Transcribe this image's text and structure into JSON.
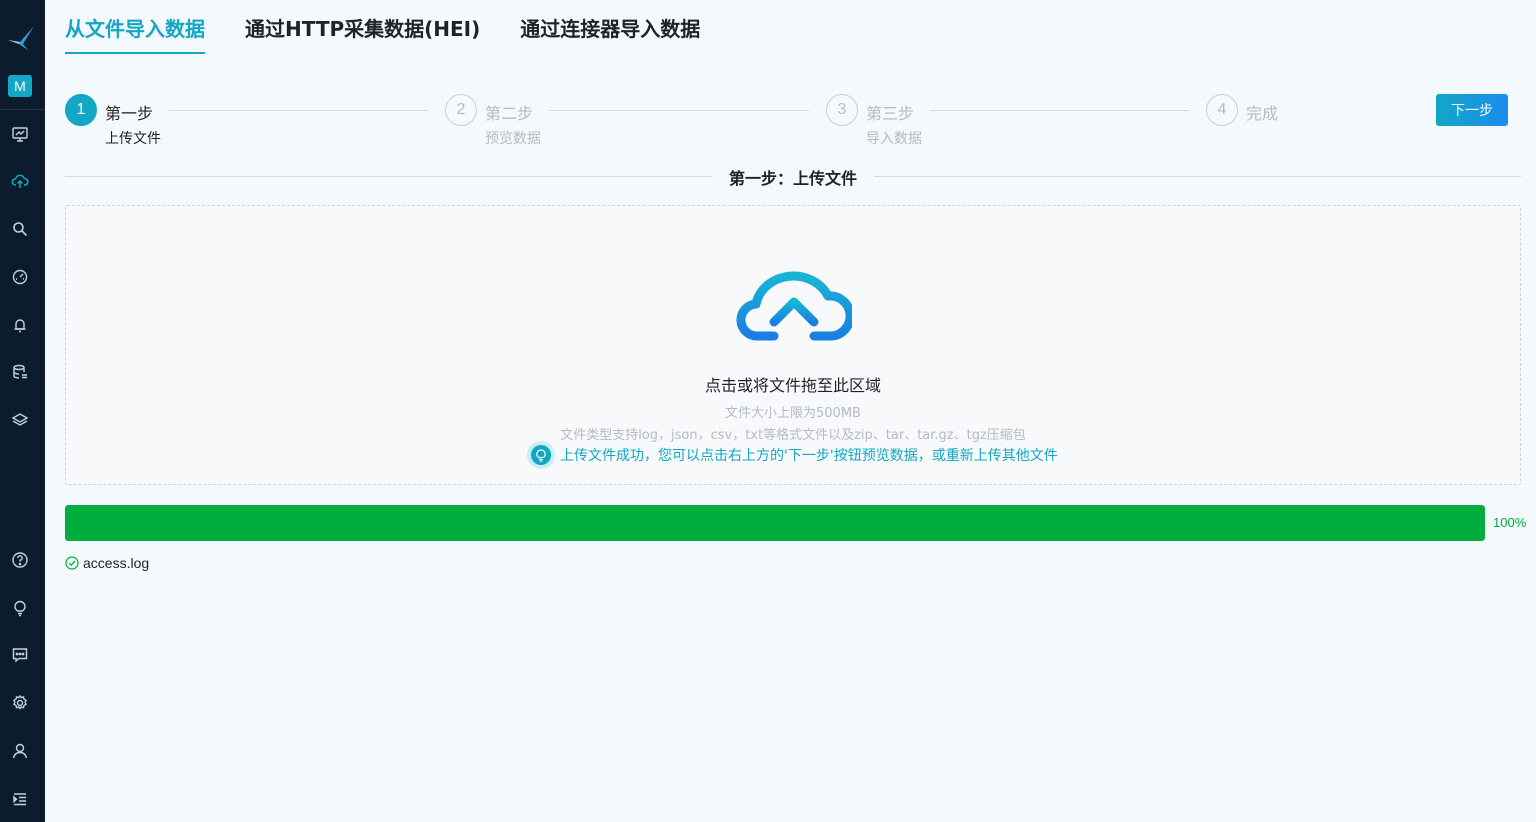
{
  "sidebar": {
    "workspace_badge": "M",
    "items": [
      {
        "icon": "dashboard-icon"
      },
      {
        "icon": "cloud-upload-icon"
      },
      {
        "icon": "search-icon"
      },
      {
        "icon": "gauge-icon"
      },
      {
        "icon": "bell-icon"
      },
      {
        "icon": "database-icon"
      },
      {
        "icon": "layers-icon"
      },
      {
        "icon": "help-icon"
      },
      {
        "icon": "lightbulb-icon"
      },
      {
        "icon": "message-icon"
      },
      {
        "icon": "settings-icon"
      },
      {
        "icon": "user-icon"
      },
      {
        "icon": "menu-indent-icon"
      }
    ]
  },
  "tabs": [
    {
      "label": "从文件导入数据",
      "active": true
    },
    {
      "label": "通过HTTP采集数据(HEI)",
      "active": false
    },
    {
      "label": "通过连接器导入数据",
      "active": false
    }
  ],
  "steps": [
    {
      "number": "1",
      "title": "第一步",
      "desc": "上传文件",
      "active": true
    },
    {
      "number": "2",
      "title": "第二步",
      "desc": "预览数据",
      "active": false
    },
    {
      "number": "3",
      "title": "第三步",
      "desc": "导入数据",
      "active": false
    },
    {
      "number": "4",
      "title": "完成",
      "desc": "",
      "active": false
    }
  ],
  "next_button": "下一步",
  "section_title": "第一步：上传文件",
  "upload": {
    "main_text": "点击或将文件拖至此区域",
    "size_limit": "文件大小上限为500MB",
    "types": "文件类型支持log，json，csv，txt等格式文件以及zip、tar、tar.gz、tgz压缩包",
    "success": "上传文件成功，您可以点击右上方的'下一步'按钮预览数据，或重新上传其他文件"
  },
  "progress": {
    "percent": 100,
    "label": "100%"
  },
  "file": {
    "name": "access.log",
    "status": "success"
  },
  "colors": {
    "accent": "#12a7c4",
    "success": "#00ae3d",
    "sidebar": "#0b1c2c"
  }
}
